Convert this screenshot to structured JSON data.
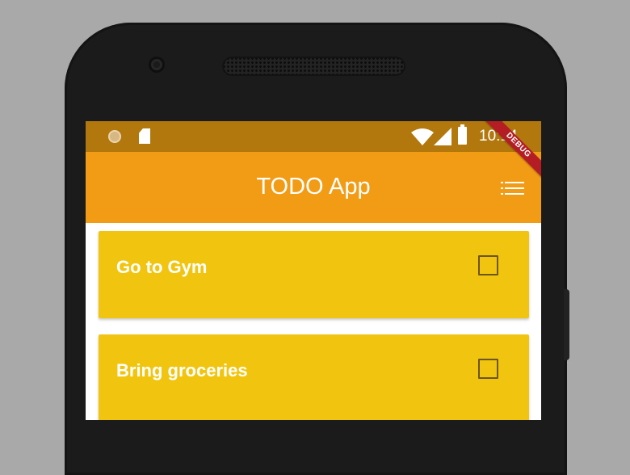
{
  "status_bar": {
    "time": "10:14"
  },
  "debug_banner": "DEBUG",
  "app_bar": {
    "title": "TODO App",
    "menu_icon": "list-menu-icon"
  },
  "todos": [
    {
      "text": "Go to Gym",
      "checked": false
    },
    {
      "text": "Bring groceries",
      "checked": false
    }
  ],
  "colors": {
    "status_bar": "#b2780d",
    "app_bar": "#f29c16",
    "card": "#f1c50f",
    "checkbox_border": "#6b5613",
    "debug_banner": "#b51d24",
    "phone_bezel": "#1b1b1b",
    "background": "#a9a9a9"
  }
}
